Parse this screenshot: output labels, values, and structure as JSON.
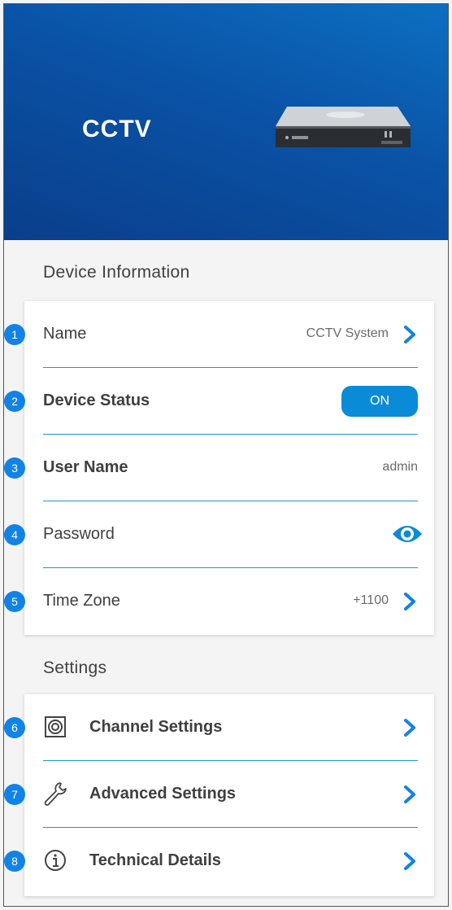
{
  "header": {
    "title": "CCTV"
  },
  "device_info": {
    "section_title": "Device Information",
    "rows": [
      {
        "badge": "1",
        "label": "Name",
        "value": "CCTV System"
      },
      {
        "badge": "2",
        "label": "Device Status",
        "toggle": "ON"
      },
      {
        "badge": "3",
        "label": "User Name",
        "value": "admin"
      },
      {
        "badge": "4",
        "label": "Password"
      },
      {
        "badge": "5",
        "label": "Time Zone",
        "value": "+1100"
      }
    ]
  },
  "settings": {
    "section_title": "Settings",
    "rows": [
      {
        "badge": "6",
        "label": "Channel Settings",
        "icon": "channel-icon"
      },
      {
        "badge": "7",
        "label": "Advanced Settings",
        "icon": "wrench-icon"
      },
      {
        "badge": "8",
        "label": "Technical Details",
        "icon": "info-icon"
      }
    ]
  },
  "colors": {
    "accent": "#0a8bd8",
    "badge": "#1283e6",
    "header_dark": "#0a3e8a"
  }
}
